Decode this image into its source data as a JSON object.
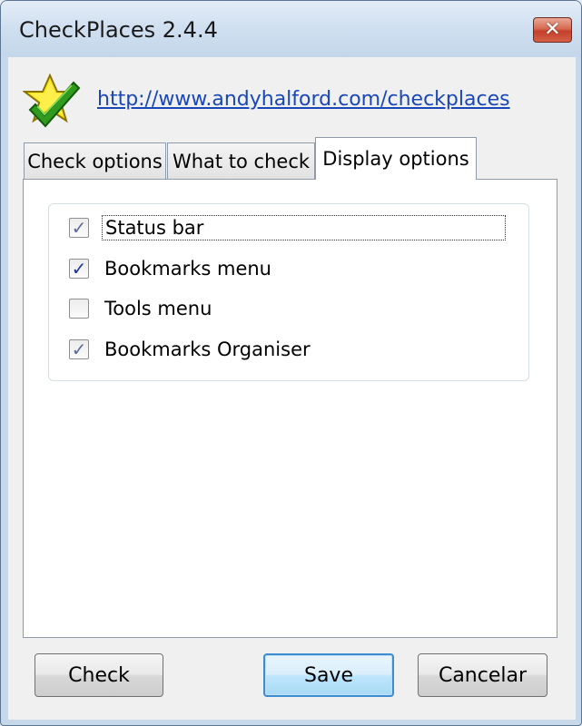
{
  "window": {
    "title": "CheckPlaces 2.4.4",
    "close_icon": "close-x-icon",
    "logo_icon": "star-checkmark-icon"
  },
  "link": {
    "url_text": "http://www.andyhalford.com/checkplaces"
  },
  "tabs": [
    {
      "label": "Check options",
      "active": false
    },
    {
      "label": "What to check",
      "active": false
    },
    {
      "label": "Display options",
      "active": true
    }
  ],
  "display_options": [
    {
      "label": "Status bar",
      "checked": true,
      "focused": true
    },
    {
      "label": "Bookmarks menu",
      "checked": true,
      "focused": false
    },
    {
      "label": "Tools menu",
      "checked": false,
      "focused": false
    },
    {
      "label": "Bookmarks Organiser",
      "checked": true,
      "focused": false
    }
  ],
  "buttons": {
    "check": "Check",
    "save": "Save",
    "cancel": "Cancelar"
  },
  "colors": {
    "link": "#1a47b8",
    "check_mark": "#21349b",
    "default_button_border": "#3c8ccf",
    "close_button": "#c4402a"
  }
}
